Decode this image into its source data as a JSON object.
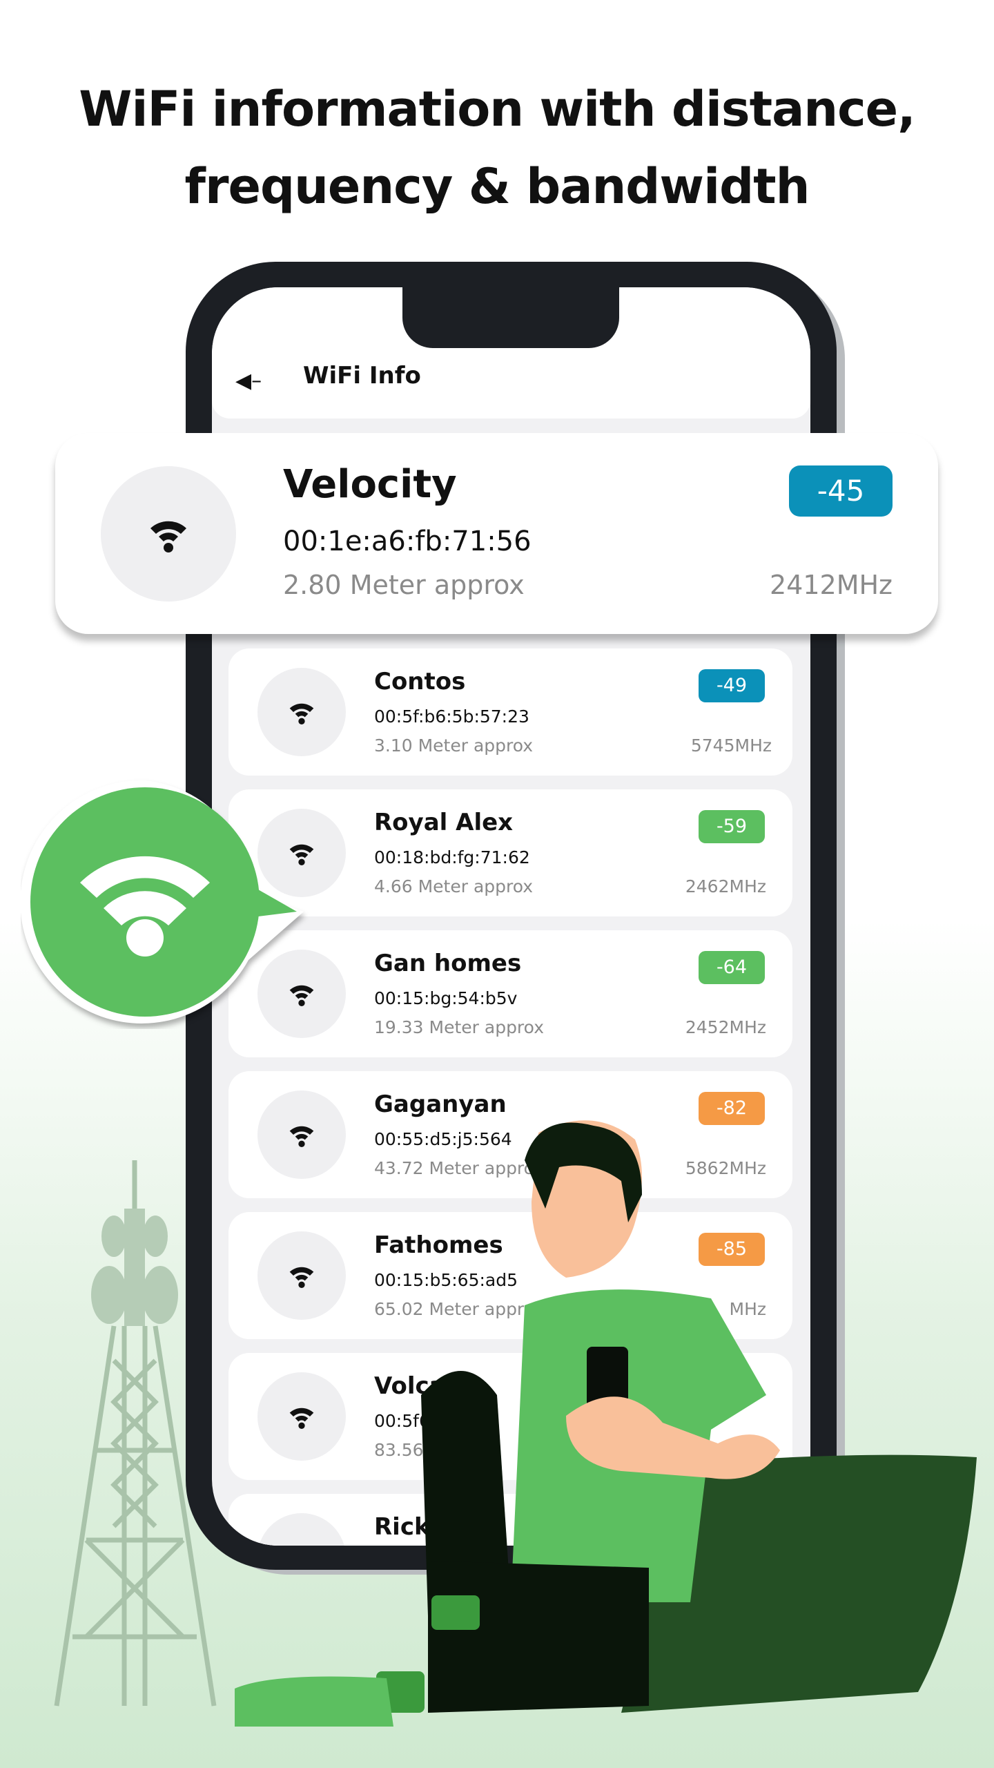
{
  "headline": {
    "line1": "WiFi information with distance,",
    "line2": "frequency & bandwidth"
  },
  "app": {
    "title": "WiFi Info",
    "back_icon": "back-arrow-icon"
  },
  "colors": {
    "blue": "#0b91b9",
    "green": "#5cbf60",
    "orange": "#f59a45",
    "frame": "#1c1f24"
  },
  "featured": {
    "name": "Velocity",
    "mac": "00:1e:a6:fb:71:56",
    "distance": "2.80 Meter approx",
    "frequency": "2412MHz",
    "signal": "-45",
    "badge_color": "#0b91b9"
  },
  "networks": [
    {
      "name": "Contos",
      "mac": "00:5f:b6:5b:57:23",
      "distance": "3.10 Meter approx",
      "frequency": "5745MHz",
      "signal": "-49",
      "badge_color": "#0b91b9"
    },
    {
      "name": "Royal Alex",
      "mac": "00:18:bd:fg:71:62",
      "distance": "4.66 Meter approx",
      "frequency": "2462MHz",
      "signal": "-59",
      "badge_color": "#5cbf60"
    },
    {
      "name": "Gan homes",
      "mac": "00:15:bg:54:b5v",
      "distance": "19.33 Meter approx",
      "frequency": "2452MHz",
      "signal": "-64",
      "badge_color": "#5cbf60"
    },
    {
      "name": "Gaganyan",
      "mac": "00:55:d5:j5:564",
      "distance": "43.72 Meter approx",
      "frequency": "5862MHz",
      "signal": "-82",
      "badge_color": "#f59a45"
    },
    {
      "name": "Fathomes",
      "mac": "00:15:b5:65:ad5",
      "distance": "65.02 Meter approx",
      "frequency": "MHz",
      "signal": "-85",
      "badge_color": "#f59a45"
    },
    {
      "name": "Volca",
      "mac": "00:5f6",
      "distance": "83.56",
      "frequency": "",
      "signal": "",
      "badge_color": ""
    },
    {
      "name": "Rick",
      "mac": "",
      "distance": "",
      "frequency": "",
      "signal": "",
      "badge_color": ""
    }
  ]
}
